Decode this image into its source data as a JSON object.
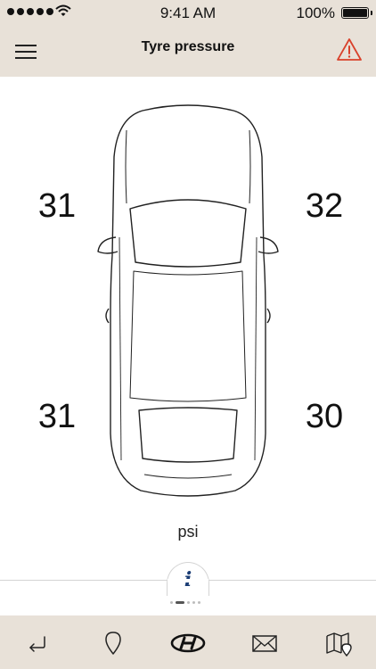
{
  "status_bar": {
    "time": "9:41 AM",
    "battery_percent": "100%",
    "icons": [
      "signal-dots-icon",
      "wifi-icon",
      "battery-icon"
    ]
  },
  "nav": {
    "title": "Tyre pressure",
    "left_icon": "hamburger-menu-icon",
    "right_icon": "warning-triangle-icon",
    "warning_color": "#d9412b"
  },
  "tyres": {
    "front_left": "31",
    "front_right": "32",
    "rear_left": "31",
    "rear_right": "30",
    "unit": "psi"
  },
  "info_tab": {
    "glyph": "i",
    "icon": "info-icon",
    "color": "#1a3c74"
  },
  "pager": {
    "count": 5,
    "active_index": 1
  },
  "tab_bar": {
    "icons": [
      "back-arrow-icon",
      "location-pin-icon",
      "brand-logo-icon",
      "mail-icon",
      "map-icon"
    ]
  },
  "colors": {
    "chrome_background": "#e8e1d8",
    "content_background": "#ffffff"
  }
}
